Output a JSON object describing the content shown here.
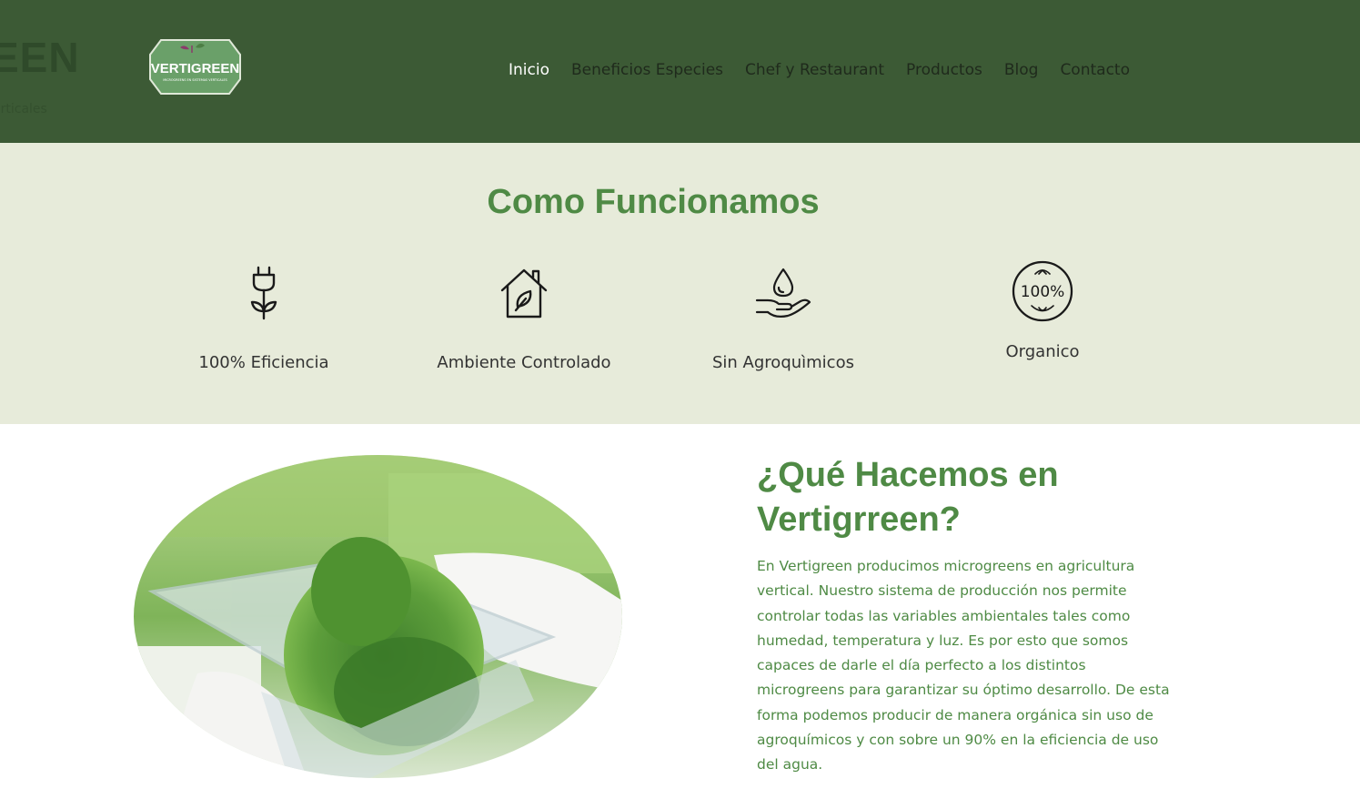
{
  "header": {
    "ghost_title": "EEN",
    "ghost_subtitle": "erticales",
    "logo": {
      "text": "VERTIGREEN",
      "tagline": "MICROGREENS EN SISTEMAS VERTICALES"
    },
    "nav": [
      {
        "label": "Inicio",
        "active": true
      },
      {
        "label": "Beneficios Especies",
        "active": false
      },
      {
        "label": "Chef y Restaurant",
        "active": false
      },
      {
        "label": "Productos",
        "active": false
      },
      {
        "label": "Blog",
        "active": false
      },
      {
        "label": "Contacto",
        "active": false
      }
    ]
  },
  "features": {
    "title": "Como Funcionamos",
    "items": [
      {
        "icon": "plug-plant-icon",
        "label": "100% Eficiencia"
      },
      {
        "icon": "house-leaf-icon",
        "label": "Ambiente Controlado"
      },
      {
        "icon": "hand-drop-icon",
        "label": "Sin Agroquìmicos"
      },
      {
        "icon": "organic-badge-icon",
        "label": "Organico",
        "badge_text": "100%"
      }
    ]
  },
  "about": {
    "title": "¿Qué Hacemos en Vertigrreen?",
    "body": "En Vertigreen producimos microgreens en agricultura vertical. Nuestro sistema de producción nos permite controlar todas las variables ambientales tales como humedad, temperatura y luz. Es por esto que somos capaces de darle el día perfecto a los distintos microgreens para garantizar su óptimo desarrollo. De esta forma podemos producir de manera orgánica sin uso de agroquímicos y con sobre un 90% en la eficiencia de uso del agua.",
    "image": "microgreens-tray-photo"
  },
  "colors": {
    "header_bg": "#3c5a35",
    "features_bg": "#e7ebda",
    "accent_green": "#4f8a45",
    "nav_active": "#ffffff"
  }
}
